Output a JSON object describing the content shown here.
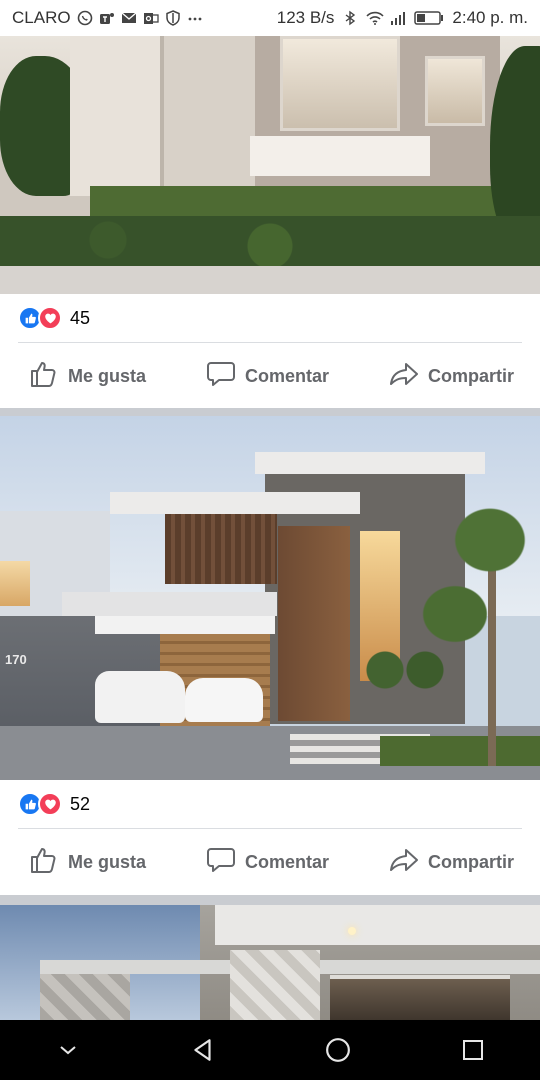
{
  "status_bar": {
    "carrier": "CLARO",
    "net_speed": "123 B/s",
    "time": "2:40 p. m.",
    "left_icons": [
      "whatsapp-icon",
      "teams-icon",
      "mail-icon",
      "outlook-icon",
      "shield-icon",
      "more-dots-icon"
    ],
    "right_icons": [
      "bluetooth-icon",
      "wifi-icon",
      "signal-icon",
      "battery-icon"
    ]
  },
  "posts": [
    {
      "image": "modern-house-photo",
      "reaction_count": "45",
      "reaction_icons": [
        "like-reaction-icon",
        "love-reaction-icon"
      ],
      "actions": {
        "like": "Me gusta",
        "comment": "Comentar",
        "share": "Compartir"
      }
    },
    {
      "image": "modern-house-night-photo",
      "house_number": "170",
      "reaction_count": "52",
      "reaction_icons": [
        "like-reaction-icon",
        "love-reaction-icon"
      ],
      "actions": {
        "like": "Me gusta",
        "comment": "Comentar",
        "share": "Compartir"
      }
    },
    {
      "image": "modern-house-dusk-photo"
    }
  ],
  "colors": {
    "like_blue": "#1877f2",
    "love_red": "#f33e58",
    "action_gray": "#65676b",
    "separator": "#c9ccd1"
  },
  "nav_bar": [
    "chevron-down-icon",
    "back-icon",
    "home-icon",
    "recents-icon"
  ]
}
